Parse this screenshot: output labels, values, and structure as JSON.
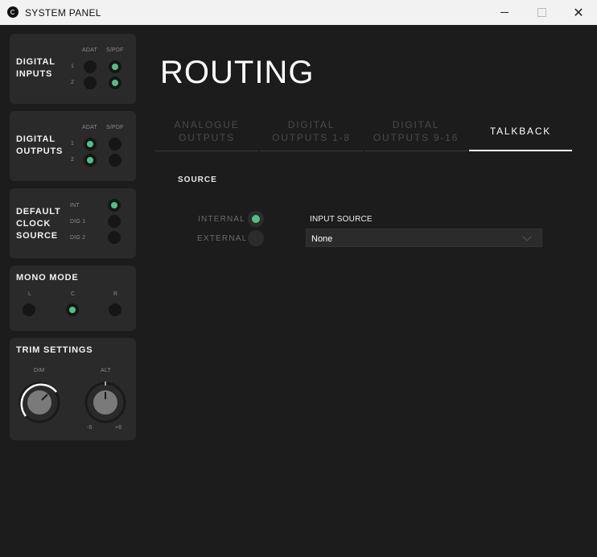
{
  "window": {
    "title": "SYSTEM PANEL",
    "logo_icon": "app-logo-icon",
    "minimize_icon": "minimize-icon",
    "maximize_icon": "maximize-icon",
    "close_icon": "close-icon",
    "close_glyph": "✕"
  },
  "accent_color": "#4fbf8a",
  "sidebar": {
    "digital_inputs": {
      "title": "DIGITAL\nINPUTS",
      "col_a": "ADAT",
      "col_b": "S/PDF",
      "rows": [
        "1",
        "2"
      ],
      "states": {
        "adat": [
          false,
          false
        ],
        "spdf": [
          true,
          true
        ]
      }
    },
    "digital_outputs": {
      "title": "DIGITAL\nOUTPUTS",
      "col_a": "ADAT",
      "col_b": "S/PDF",
      "rows": [
        "1",
        "2"
      ],
      "states": {
        "adat": [
          true,
          true
        ],
        "spdf": [
          false,
          false
        ]
      }
    },
    "clock_source": {
      "title": "DEFAULT\nCLOCK\nSOURCE",
      "options": [
        "INT",
        "DIG 1",
        "DIG 2"
      ],
      "selected": "INT"
    },
    "mono_mode": {
      "title": "MONO MODE",
      "options": [
        "L",
        "C",
        "R"
      ],
      "selected": "C"
    },
    "trim_settings": {
      "title": "TRIM SETTINGS",
      "dim_label": "DIM",
      "alt_label": "ALT",
      "alt_min": "-6",
      "alt_max": "+6"
    }
  },
  "main": {
    "title": "ROUTING",
    "tabs": [
      {
        "label": "ANALOGUE\nOUTPUTS",
        "active": false
      },
      {
        "label": "DIGITAL\nOUTPUTS 1-8",
        "active": false
      },
      {
        "label": "DIGITAL\nOUTPUTS 9-16",
        "active": false
      },
      {
        "label": "TALKBACK",
        "active": true
      }
    ],
    "source": {
      "label": "SOURCE",
      "internal_label": "INTERNAL",
      "external_label": "EXTERNAL",
      "selected": "INTERNAL",
      "input_source_label": "INPUT SOURCE",
      "input_source_value": "None"
    }
  }
}
